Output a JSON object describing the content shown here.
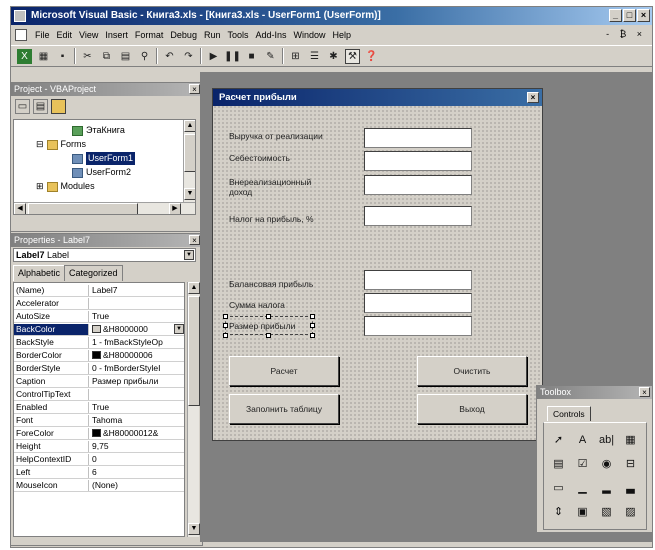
{
  "window": {
    "title": "Microsoft Visual Basic - Книга3.xls - [Книга3.xls - UserForm1 (UserForm)]",
    "controls": [
      "_",
      "□",
      "×"
    ]
  },
  "menu": {
    "items": [
      "File",
      "Edit",
      "View",
      "Insert",
      "Format",
      "Debug",
      "Run",
      "Tools",
      "Add-Ins",
      "Window",
      "Help"
    ],
    "right": "- ₿ ×"
  },
  "project": {
    "title": "Project - VBAProject",
    "tree": [
      {
        "label": "ЭтаКнига",
        "icon": "workbook-icon"
      },
      {
        "label": "Forms",
        "icon": "folder-icon"
      },
      {
        "label": "UserForm1",
        "icon": "form-icon"
      },
      {
        "label": "UserForm2",
        "icon": "form-icon"
      },
      {
        "label": "Modules",
        "icon": "folder-icon"
      }
    ],
    "expanders": [
      "⊟",
      "⊞"
    ]
  },
  "properties": {
    "title": "Properties - Label7",
    "object": "Label7",
    "object_type": "Label",
    "tabs": [
      "Alphabetic",
      "Categorized"
    ],
    "rows": [
      {
        "name": "(Name)",
        "value": "Label7"
      },
      {
        "name": "Accelerator",
        "value": ""
      },
      {
        "name": "AutoSize",
        "value": "True"
      },
      {
        "name": "BackColor",
        "value": "&H8000000",
        "swatch": "#d4d0c8"
      },
      {
        "name": "BackStyle",
        "value": "1 - fmBackStyleOp"
      },
      {
        "name": "BorderColor",
        "value": "&H80000006",
        "swatch": "#000000"
      },
      {
        "name": "BorderStyle",
        "value": "0 - fmBorderStyleI"
      },
      {
        "name": "Caption",
        "value": "Размер прибыли"
      },
      {
        "name": "ControlTipText",
        "value": ""
      },
      {
        "name": "Enabled",
        "value": "True"
      },
      {
        "name": "Font",
        "value": "Tahoma"
      },
      {
        "name": "ForeColor",
        "value": "&H80000012&",
        "swatch": "#000000"
      },
      {
        "name": "Height",
        "value": "9,75"
      },
      {
        "name": "HelpContextID",
        "value": "0"
      },
      {
        "name": "Left",
        "value": "6"
      },
      {
        "name": "MouseIcon",
        "value": "(None)"
      }
    ]
  },
  "form": {
    "title": "Расчет прибыли",
    "labels": {
      "revenue": "Выручка от реализации",
      "cost": "Себестоимость",
      "nonop": "Внереализационный доход",
      "taxrate": "Налог на прибыль, %",
      "balance": "Балансовая прибыль",
      "taxsum": "Сумма налога",
      "profit": "Размер прибыли"
    },
    "buttons": {
      "calc": "Расчет",
      "clear": "Очистить",
      "fill": "Заполнить таблицу",
      "exit": "Выход"
    }
  },
  "toolbox": {
    "title": "Toolbox",
    "tab": "Controls",
    "glyphs": [
      "➚",
      "A",
      "ab|",
      "▦",
      "▤",
      "☑",
      "◉",
      "⊟",
      "▭",
      "▁",
      "▂",
      "▃",
      "⇕",
      "▣",
      "▧",
      "▨"
    ]
  }
}
